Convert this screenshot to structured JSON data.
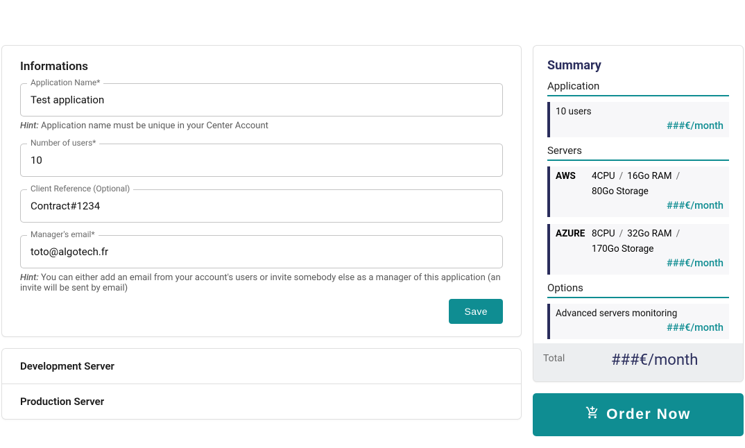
{
  "info": {
    "title": "Informations",
    "appName": {
      "label": "Application Name*",
      "value": "Test application",
      "hint_prefix": "Hint:",
      "hint": "Application name must be unique in your Center Account"
    },
    "numUsers": {
      "label": "Number of users*",
      "value": "10"
    },
    "clientRef": {
      "label": "Client Reference (Optional)",
      "value": "Contract#1234"
    },
    "managerEmail": {
      "label": "Manager's email*",
      "value": "toto@algotech.fr",
      "hint_prefix": "Hint:",
      "hint": "You can either add an email from your account's users or invite somebody else as a manager of this application (an invite will be sent by email)"
    },
    "saveLabel": "Save"
  },
  "accordion": {
    "dev": "Development Server",
    "prod": "Production Server"
  },
  "summary": {
    "title": "Summary",
    "appHeader": "Application",
    "appLine": "10 users",
    "appPrice": "###€/month",
    "serversHeader": "Servers",
    "server1": {
      "provider": "AWS",
      "cpu": "4CPU",
      "ram": "16Go RAM",
      "storage": "80Go Storage",
      "price": "###€/month"
    },
    "server2": {
      "provider": "AZURE",
      "cpu": "8CPU",
      "ram": "32Go RAM",
      "storage": "170Go Storage",
      "price": "###€/month"
    },
    "optionsHeader": "Options",
    "option1": {
      "label": "Advanced servers monitoring",
      "price": "###€/month"
    },
    "totalLabel": "Total",
    "totalValue": "###€/month"
  },
  "order": {
    "label": "Order Now"
  },
  "sep": "/"
}
